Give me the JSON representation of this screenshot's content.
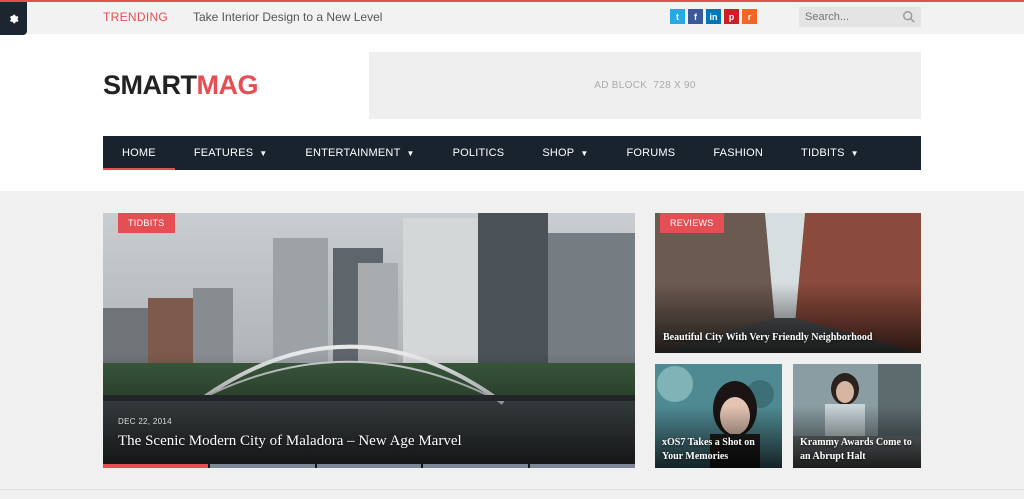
{
  "topbar": {
    "trending_label": "TRENDING",
    "trending_headline": "Take Interior Design to a New Level",
    "search_placeholder": "Search...",
    "socials": [
      {
        "icon": "twitter-icon",
        "glyph": "t",
        "color": "#28a9e1"
      },
      {
        "icon": "facebook-icon",
        "glyph": "f",
        "color": "#3b5998"
      },
      {
        "icon": "linkedin-icon",
        "glyph": "in",
        "color": "#0077b5"
      },
      {
        "icon": "pinterest-icon",
        "glyph": "p",
        "color": "#cb2027"
      },
      {
        "icon": "rss-icon",
        "glyph": "r",
        "color": "#f26522"
      }
    ]
  },
  "header": {
    "logo_part1": "SMART",
    "logo_part2": "MAG",
    "ad_text": "AD BLOCK  728 X 90"
  },
  "nav": {
    "items": [
      {
        "label": "HOME",
        "dropdown": false,
        "active": true
      },
      {
        "label": "FEATURES",
        "dropdown": true
      },
      {
        "label": "ENTERTAINMENT",
        "dropdown": true
      },
      {
        "label": "POLITICS",
        "dropdown": false
      },
      {
        "label": "SHOP",
        "dropdown": true
      },
      {
        "label": "FORUMS",
        "dropdown": false
      },
      {
        "label": "FASHION",
        "dropdown": false
      },
      {
        "label": "TIDBITS",
        "dropdown": true
      }
    ]
  },
  "featured": {
    "main": {
      "category": "TIDBITS",
      "date": "DEC 22, 2014",
      "title": "The Scenic Modern City of Maladora – New Age Marvel"
    },
    "top_right": {
      "category": "REVIEWS",
      "title": "Beautiful City With Very Friendly Neighborhood"
    },
    "small_left": {
      "title": "xOS7 Takes a Shot on Your Memories"
    },
    "small_right": {
      "title": "Krammy Awards Come to an Abrupt Halt"
    }
  },
  "colors": {
    "accent": "#e54e53",
    "nav_bg": "#19232d"
  }
}
